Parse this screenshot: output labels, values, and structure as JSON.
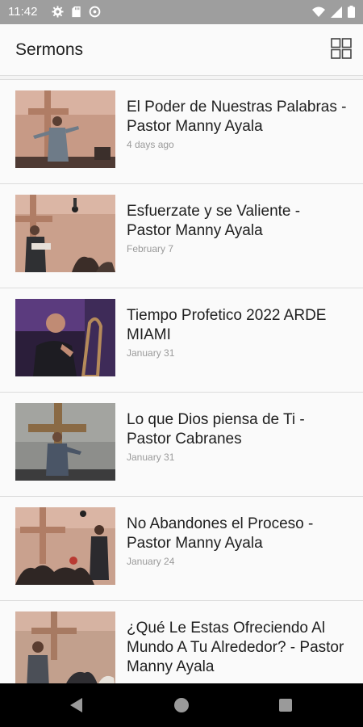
{
  "status_bar": {
    "time": "11:42",
    "left_icons": [
      "settings-icon",
      "sd-card-icon",
      "sync-icon"
    ],
    "right_icons": [
      "wifi-icon",
      "signal-icon",
      "battery-icon"
    ]
  },
  "app_bar": {
    "title": "Sermons",
    "view_toggle_icon": "grid-view-icon"
  },
  "sermons": [
    {
      "title": "El Poder de Nuestras Palabras - Pastor Manny Ayala",
      "date": "4 days ago"
    },
    {
      "title": "Esfuerzate y se Valiente  - Pastor Manny Ayala",
      "date": "February 7"
    },
    {
      "title": "Tiempo Profetico 2022 ARDE MIAMI",
      "date": "January 31"
    },
    {
      "title": "Lo que Dios piensa de Ti - Pastor Cabranes",
      "date": "January 31"
    },
    {
      "title": "No Abandones el Proceso - Pastor Manny Ayala",
      "date": "January 24"
    },
    {
      "title": "¿Qué Le Estas Ofreciendo Al Mundo A Tu Alrededor? - Pastor Manny Ayala",
      "date": ""
    }
  ],
  "nav_bar": {
    "icons": [
      "back-icon",
      "home-icon",
      "recent-apps-icon"
    ]
  },
  "colors": {
    "status_bar": "#9e9e9e",
    "app_bar": "#fafafa",
    "divider": "#dcdcdc",
    "title_text": "#1f1f1f",
    "date_text": "#9a9a9a",
    "nav_bar": "#000000"
  }
}
